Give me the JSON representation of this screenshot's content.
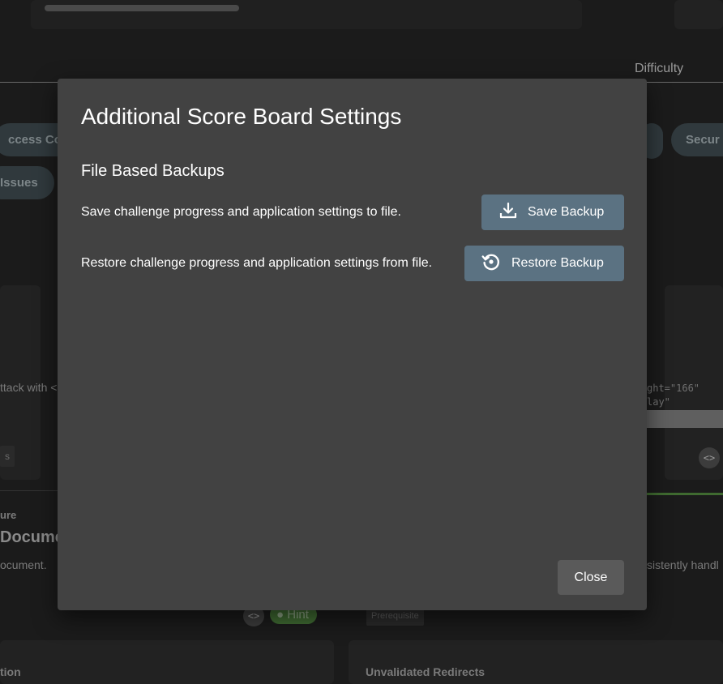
{
  "background": {
    "difficulty_label": "Difficulty",
    "chips": [
      "ccess Con",
      "Secur",
      "Issues"
    ],
    "attack_text": "ttack with <",
    "code_lines": [
      "ght=\"166\"",
      "lay\""
    ],
    "tag_small": "s",
    "code_icon": "<>",
    "section_ure": "ure",
    "document_title": "Documen",
    "document_text": "ocument.",
    "handle_text": "sistently handl",
    "hint_label": "Hint",
    "prerequisite_label": "Prerequisite",
    "bottom_left": "tion",
    "bottom_right": "Unvalidated Redirects"
  },
  "modal": {
    "title": "Additional Score Board Settings",
    "section": "File Based Backups",
    "save_row_text": "Save challenge progress and application settings to file.",
    "save_button": "Save Backup",
    "save_icon": "download-icon",
    "restore_row_text": "Restore challenge progress and application settings from file.",
    "restore_button": "Restore Backup",
    "restore_icon": "restore-icon",
    "close_button": "Close"
  },
  "colors": {
    "modal_bg": "#424242",
    "button_primary": "#5b7282",
    "button_close": "#5a5a5a",
    "backdrop": "#1b1b1b"
  }
}
